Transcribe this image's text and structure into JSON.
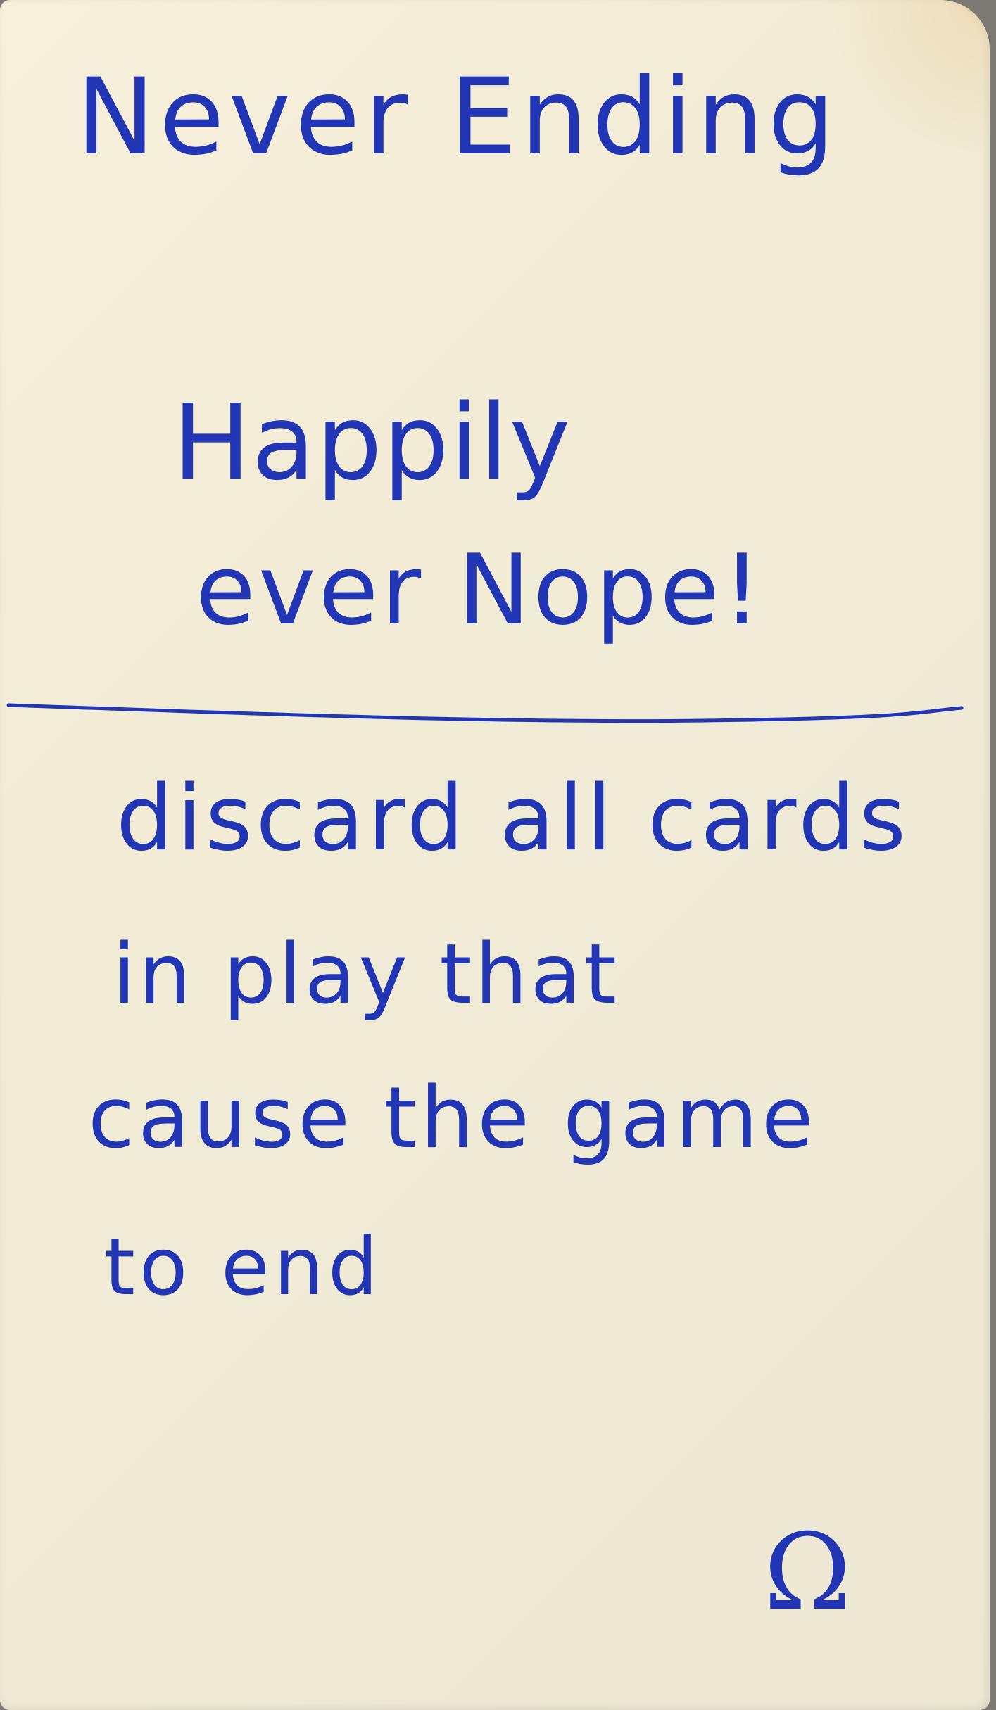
{
  "card": {
    "title": "Never Ending",
    "subtitle_line_1": "Happily",
    "subtitle_line_2": "ever Nope!",
    "rules_lines": [
      "discard all cards",
      "in  play that",
      "cause the game",
      "to  end"
    ],
    "symbol": "Ω"
  },
  "colors": {
    "ink": "#2135b5",
    "paper": "#f2ecd6"
  }
}
